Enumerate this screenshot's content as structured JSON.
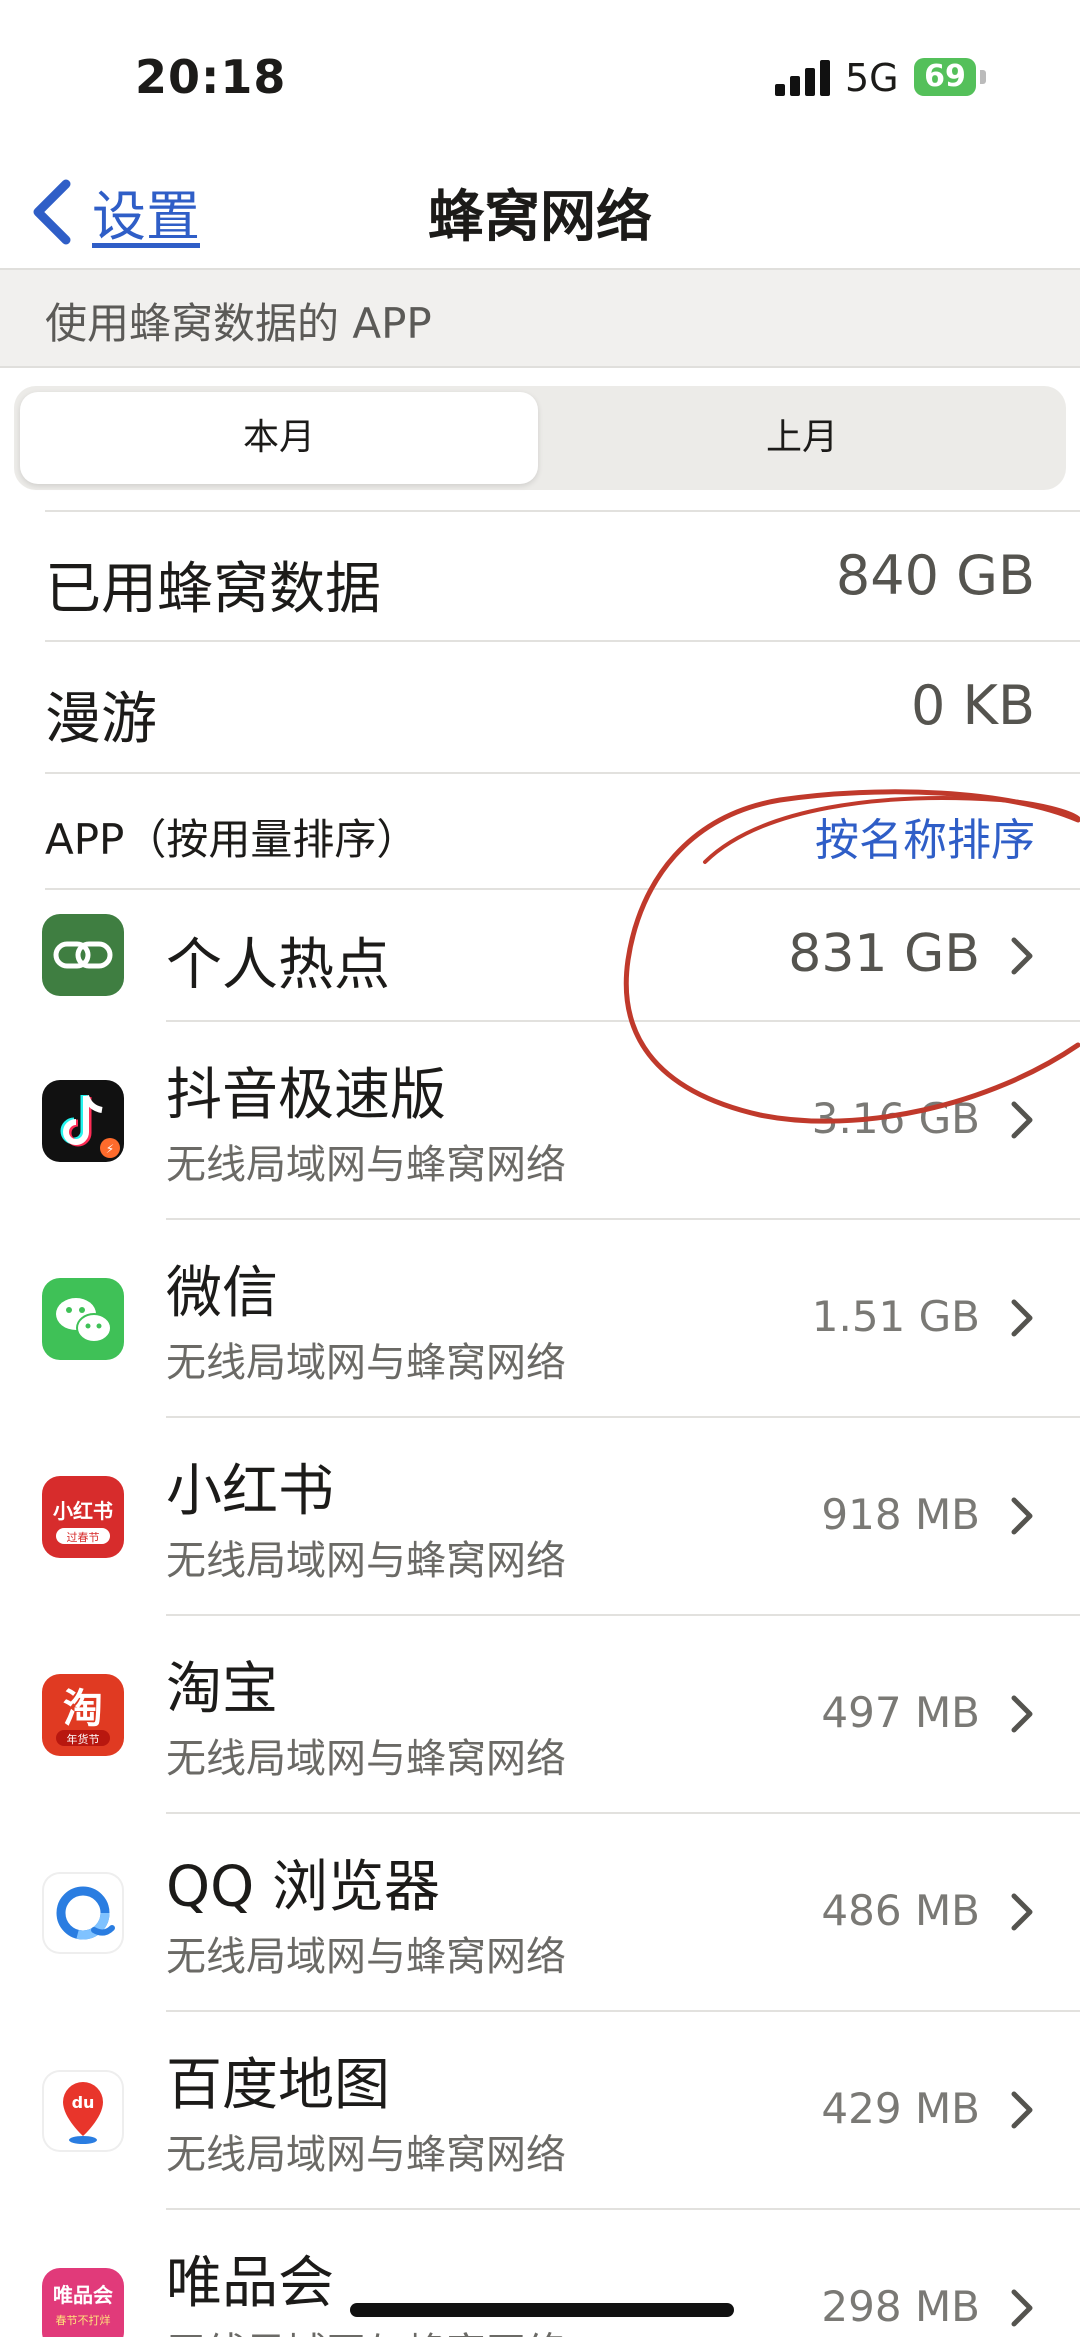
{
  "status_bar": {
    "time": "20:18",
    "network": "5G",
    "battery": "69"
  },
  "nav": {
    "back_label": "设置",
    "title": "蜂窝网络"
  },
  "section_header": "使用蜂窝数据的 APP",
  "segmented": {
    "active": "本月",
    "inactive": "上月"
  },
  "summary": [
    {
      "label": "已用蜂窝数据",
      "value": "840 GB"
    },
    {
      "label": "漫游",
      "value": "0 KB"
    }
  ],
  "apps_header": {
    "left": "APP（按用量排序）",
    "right": "按名称排序"
  },
  "apps": [
    {
      "name": "个人热点",
      "subtitle": "",
      "size": "831 GB",
      "icon": "personal-hotspot-icon",
      "color": "#3f7e41"
    },
    {
      "name": "抖音极速版",
      "subtitle": "无线局域网与蜂窝网络",
      "size": "3.16 GB",
      "icon": "douyin-icon",
      "color": "#111111",
      "badge": "⚡"
    },
    {
      "name": "微信",
      "subtitle": "无线局域网与蜂窝网络",
      "size": "1.51 GB",
      "icon": "wechat-icon",
      "color": "#3fc157"
    },
    {
      "name": "小红书",
      "subtitle": "无线局域网与蜂窝网络",
      "size": "918 MB",
      "icon": "xiaohongshu-icon",
      "color": "#d72c2c",
      "label": "小红书",
      "label2": "过春节"
    },
    {
      "name": "淘宝",
      "subtitle": "无线局域网与蜂窝网络",
      "size": "497 MB",
      "icon": "taobao-icon",
      "color": "#e03a22",
      "label": "淘",
      "label2": "年货节"
    },
    {
      "name": "QQ 浏览器",
      "subtitle": "无线局域网与蜂窝网络",
      "size": "486 MB",
      "icon": "qq-browser-icon",
      "color": "#ffffff"
    },
    {
      "name": "百度地图",
      "subtitle": "无线局域网与蜂窝网络",
      "size": "429 MB",
      "icon": "baidu-map-icon",
      "color": "#ffffff",
      "label": "du"
    },
    {
      "name": "唯品会",
      "subtitle": "无线局域网与蜂窝网络",
      "size": "298 MB",
      "icon": "vipshop-icon",
      "color": "#e13a7a",
      "label": "唯品会",
      "label2": "春节不打烊"
    }
  ],
  "colors": {
    "link": "#2f5ec7",
    "annotation": "#c0392b"
  }
}
